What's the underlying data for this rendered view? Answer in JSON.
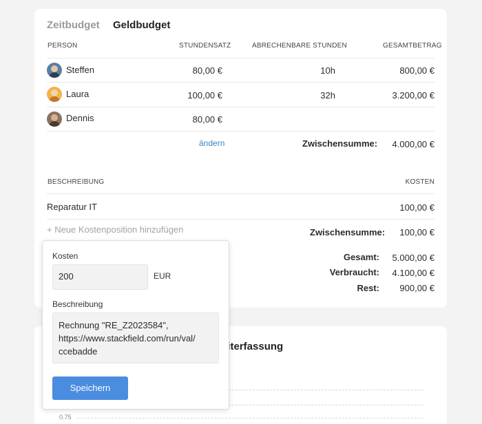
{
  "tabs": {
    "time": "Zeitbudget",
    "money": "Geldbudget"
  },
  "persons_table": {
    "headers": {
      "person": "PERSON",
      "rate": "STUNDENSATZ",
      "hours": "ABRECHENBARE STUNDEN",
      "total": "GESAMTBETRAG"
    },
    "rows": [
      {
        "name": "Steffen",
        "rate": "80,00 €",
        "hours": "10h",
        "total": "800,00 €"
      },
      {
        "name": "Laura",
        "rate": "100,00 €",
        "hours": "32h",
        "total": "3.200,00 €"
      },
      {
        "name": "Dennis",
        "rate": "80,00 €",
        "hours": "",
        "total": ""
      }
    ],
    "edit_link": "ändern",
    "subtotal_label": "Zwischensumme:",
    "subtotal_value": "4.000,00 €"
  },
  "costs_table": {
    "headers": {
      "description": "BESCHREIBUNG",
      "costs": "KOSTEN"
    },
    "rows": [
      {
        "description": "Reparatur IT",
        "cost": "100,00 €"
      }
    ],
    "add_link": "+ Neue Kostenposition hinzufügen",
    "subtotal_label": "Zwischensumme:",
    "subtotal_value": "100,00 €"
  },
  "summary": {
    "total_label": "Gesamt:",
    "total_value": "5.000,00 €",
    "used_label": "Verbraucht:",
    "used_value": "4.100,00 €",
    "rest_label": "Rest:",
    "rest_value": "900,00 €"
  },
  "popup": {
    "costs_label": "Kosten",
    "costs_value": "200",
    "currency": "EUR",
    "description_label": "Beschreibung",
    "description_line1": "Rechnung \"RE_Z2023584\",",
    "description_line2": "https://www.stackfield.com/run/val/",
    "description_line3": "ccebadde",
    "save_label": "Speichern"
  },
  "chart_card": {
    "title_fragment": "eiterfassung",
    "axis_tick": "0.75"
  },
  "colors": {
    "accent": "#4a8ce0",
    "link": "#3b82c4",
    "background": "#f3f3f4"
  }
}
